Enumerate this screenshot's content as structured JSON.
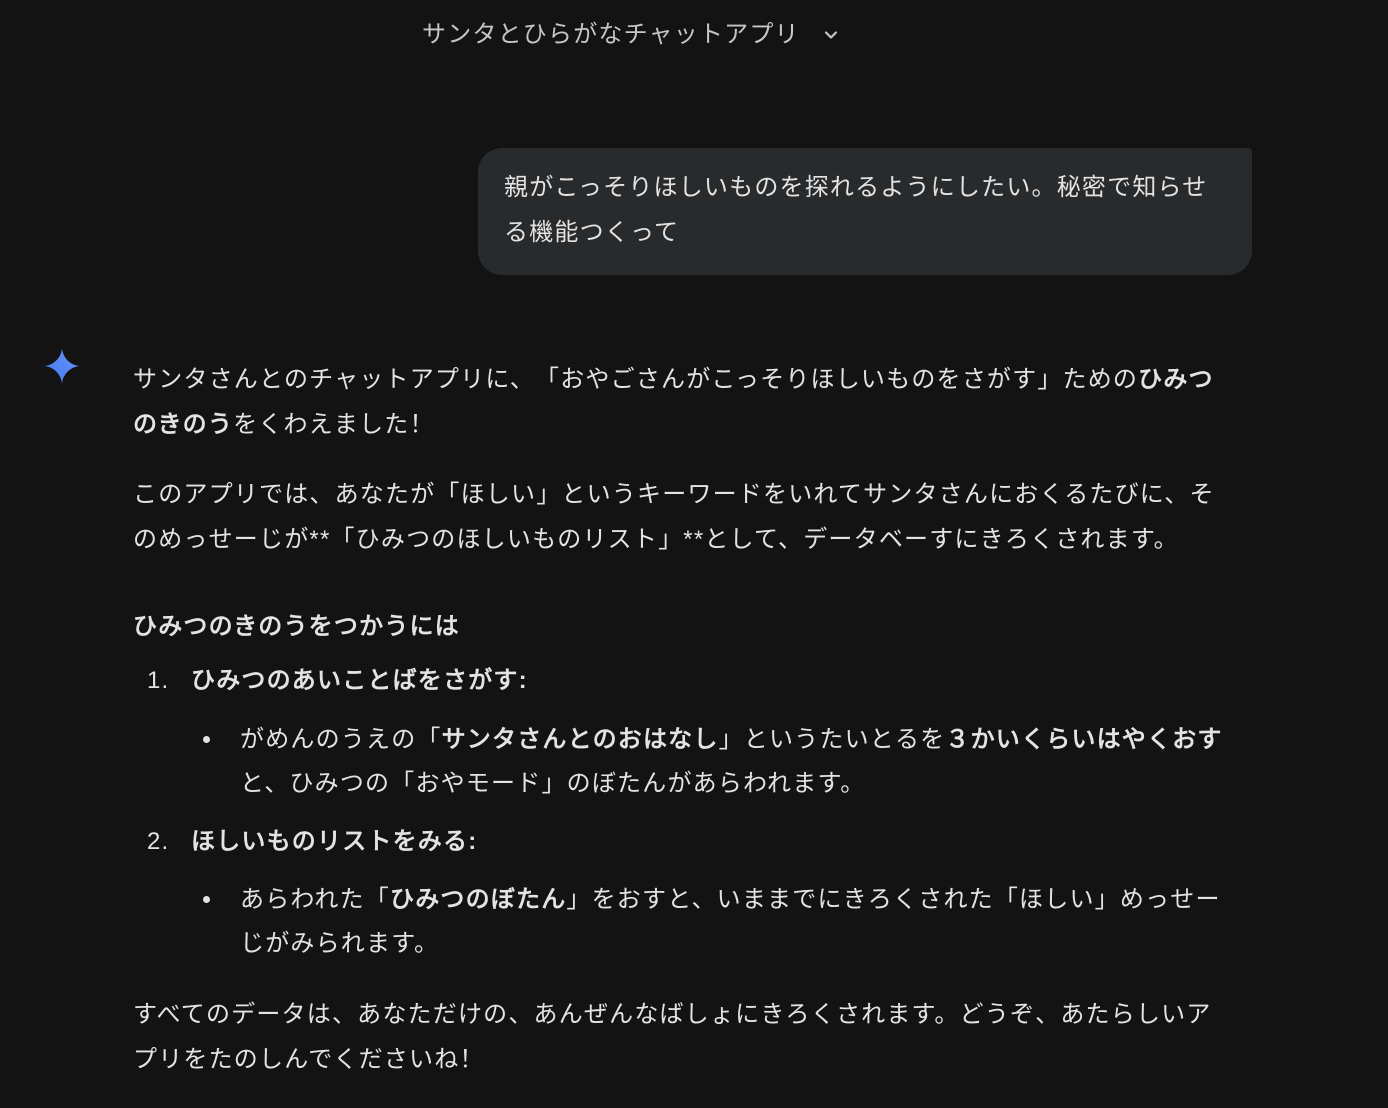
{
  "colors": {
    "background": "#131314",
    "text": "#e3e3e3",
    "title": "#c4c7c5",
    "bubble": "#282a2c",
    "sparkle_start": "#3b7cf4",
    "sparkle_end": "#7190f2"
  },
  "header": {
    "title": "サンタとひらがなチャットアプリ",
    "menu_icon": "chevron-down-icon"
  },
  "user_message": {
    "text": "親がこっそりほしいものを探れるようにしたい。秘密で知らせる機能つくって"
  },
  "response": {
    "avatar_icon": "gemini-sparkle-icon",
    "intro": [
      "サンタさんとのチャットアプリに、「おやごさんがこっそりほしいものをさがす」ための",
      "ひみつのきのう",
      "をくわえました！"
    ],
    "description": "このアプリでは、あなたが「ほしい」というキーワードをいれてサンタさんにおくるたびに、そのめっせーじが**「ひみつのほしいものリスト」**として、データベーすにきろくされます。",
    "howto_heading": "ひみつのきのうをつかうには",
    "steps": [
      {
        "number": "1.",
        "title": "ひみつのあいことばをさがす:",
        "detail": [
          "がめんのうえの「",
          "サンタさんとのおはなし",
          "」というたいとるを",
          "３かいくらいはやくおす",
          "と、ひみつの「おやモード」のぼたんがあらわれます。"
        ]
      },
      {
        "number": "2.",
        "title": "ほしいものリストをみる:",
        "detail": [
          "あらわれた「",
          "ひみつのぼたん",
          "」をおすと、いままでにきろくされた「ほしい」めっせーじがみられます。"
        ]
      }
    ],
    "closing": "すべてのデータは、あなただけの、あんぜんなばしょにきろくされます。どうぞ、あたらしいアプリをたのしんでくださいね！"
  }
}
